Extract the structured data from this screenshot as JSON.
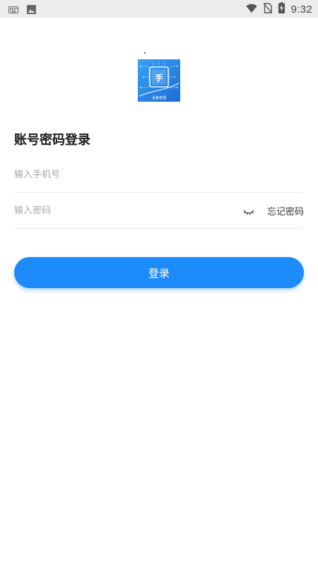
{
  "status_bar": {
    "time": "9:32",
    "icons": [
      "keyboard-icon",
      "image-icon",
      "wifi-icon",
      "no-sim-icon",
      "battery-charging-icon"
    ]
  },
  "logo": {
    "icon": "app-logo-icon",
    "caption": "设备管理",
    "glyph": "手"
  },
  "login": {
    "title": "账号密码登录",
    "phone_placeholder": "输入手机号",
    "password_placeholder": "输入密码",
    "forgot_label": "忘记密码",
    "submit_label": "登录",
    "password_visibility_icon": "eye-closed-icon"
  },
  "colors": {
    "accent": "#1e8bfa",
    "logo_bg": "#2185e8",
    "divider": "#ececec",
    "placeholder": "#a8a8a8"
  }
}
